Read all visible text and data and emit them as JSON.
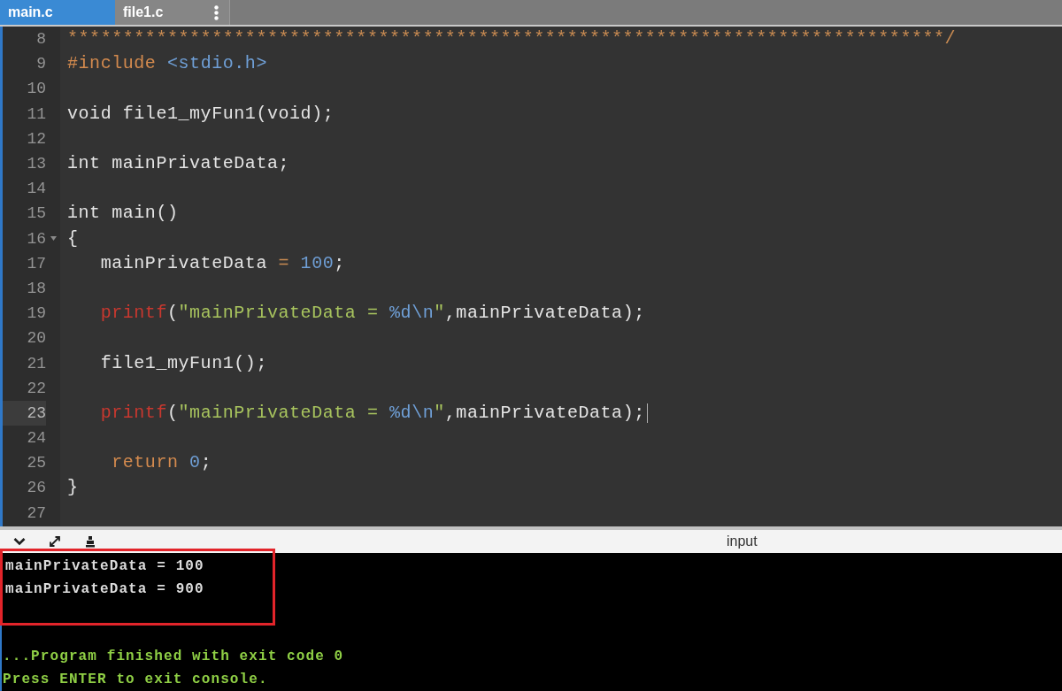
{
  "tabs": [
    {
      "label": "main.c",
      "selected": true,
      "has_menu": false
    },
    {
      "label": "file1.c",
      "selected": false,
      "has_menu": true
    }
  ],
  "editor": {
    "lines": [
      {
        "number": "8",
        "foldable": false,
        "active": false,
        "tokens": [
          {
            "kind": "comment",
            "text": "*******************************************************************************/"
          }
        ]
      },
      {
        "number": "9",
        "foldable": false,
        "active": false,
        "tokens": [
          {
            "kind": "preprocessor",
            "text": "#include"
          },
          {
            "kind": "header",
            "text": " <stdio.h>"
          }
        ]
      },
      {
        "number": "10",
        "foldable": false,
        "active": false
      },
      {
        "number": "11",
        "foldable": false,
        "active": false,
        "tokens": [
          {
            "kind": "plain",
            "text": "void file1_myFun1(void);"
          }
        ]
      },
      {
        "number": "12",
        "foldable": false,
        "active": false
      },
      {
        "number": "13",
        "foldable": false,
        "active": false,
        "tokens": [
          {
            "kind": "plain",
            "text": "int mainPrivateData;"
          }
        ]
      },
      {
        "number": "14",
        "foldable": false,
        "active": false
      },
      {
        "number": "15",
        "foldable": false,
        "active": false,
        "tokens": [
          {
            "kind": "plain",
            "text": "int main()"
          }
        ]
      },
      {
        "number": "16",
        "foldable": true,
        "active": false,
        "tokens": [
          {
            "kind": "plain",
            "text": "{"
          }
        ]
      },
      {
        "number": "17",
        "foldable": false,
        "active": false,
        "tokens": [
          {
            "kind": "plain",
            "text": "   mainPrivateData "
          },
          {
            "kind": "operator",
            "text": "="
          },
          {
            "kind": "number",
            "text": " 100"
          },
          {
            "kind": "plain",
            "text": ";"
          }
        ]
      },
      {
        "number": "18",
        "foldable": false,
        "active": false
      },
      {
        "number": "19",
        "foldable": false,
        "active": false,
        "tokens": [
          {
            "kind": "function",
            "text": "   printf"
          },
          {
            "kind": "plain",
            "text": "("
          },
          {
            "kind": "string",
            "text": "\"mainPrivateData = "
          },
          {
            "kind": "escape",
            "text": "%d\\n"
          },
          {
            "kind": "string",
            "text": "\""
          },
          {
            "kind": "plain",
            "text": ",mainPrivateData);"
          }
        ]
      },
      {
        "number": "20",
        "foldable": false,
        "active": false
      },
      {
        "number": "21",
        "foldable": false,
        "active": false,
        "tokens": [
          {
            "kind": "plain",
            "text": "   file1_myFun1();"
          }
        ]
      },
      {
        "number": "22",
        "foldable": false,
        "active": false
      },
      {
        "number": "23",
        "foldable": false,
        "active": true,
        "tokens": [
          {
            "kind": "function",
            "text": "   printf"
          },
          {
            "kind": "plain",
            "text": "("
          },
          {
            "kind": "string",
            "text": "\"mainPrivateData = "
          },
          {
            "kind": "escape",
            "text": "%d\\n"
          },
          {
            "kind": "string",
            "text": "\""
          },
          {
            "kind": "plain",
            "text": ",mainPrivateData);"
          }
        ]
      },
      {
        "number": "24",
        "foldable": false,
        "active": false
      },
      {
        "number": "25",
        "foldable": false,
        "active": false,
        "tokens": [
          {
            "kind": "keyword",
            "text": "    return"
          },
          {
            "kind": "number",
            "text": " 0"
          },
          {
            "kind": "plain",
            "text": ";"
          }
        ]
      },
      {
        "number": "26",
        "foldable": false,
        "active": false,
        "tokens": [
          {
            "kind": "plain",
            "text": "}"
          }
        ]
      },
      {
        "number": "27",
        "foldable": false,
        "active": false
      }
    ]
  },
  "console_bar": {
    "tab": "input"
  },
  "console": {
    "highlighted": true,
    "output": [
      "mainPrivateData = 100",
      "mainPrivateData = 900"
    ],
    "status": [
      "...Program finished with exit code 0",
      "Press ENTER to exit console."
    ]
  }
}
